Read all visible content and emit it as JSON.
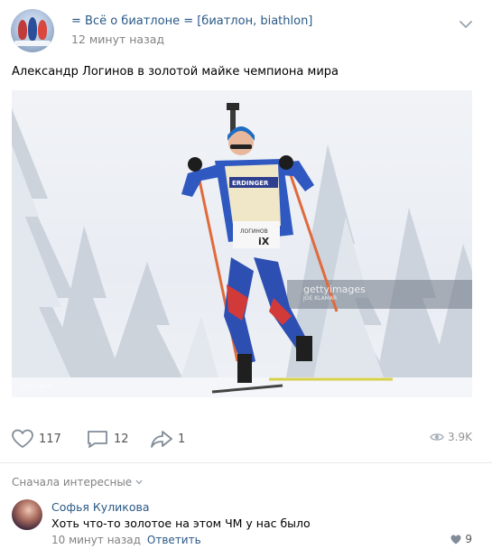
{
  "header": {
    "group_name": "= Всё о биатлоне = [биатлон, biathlon]",
    "time": "12 минут назад"
  },
  "post": {
    "text": "Александр Логинов в золотой майке чемпиона мира",
    "photo": {
      "watermark": "gettyimages",
      "watermark_credit": "JOE KLAMAR",
      "image_id": "1295118631"
    }
  },
  "actions": {
    "likes": "117",
    "comments": "12",
    "shares": "1",
    "views": "3.9K"
  },
  "comments_section": {
    "sort_label": "Сначала интересные",
    "comment": {
      "author": "Софья Куликова",
      "text": "Хоть что-то золотое на этом ЧМ у нас было",
      "time": "10 минут назад",
      "reply_label": "Ответить",
      "likes": "9"
    }
  },
  "colors": {
    "link": "#2a5885",
    "muted": "#828282",
    "icon": "#99a2ad"
  }
}
